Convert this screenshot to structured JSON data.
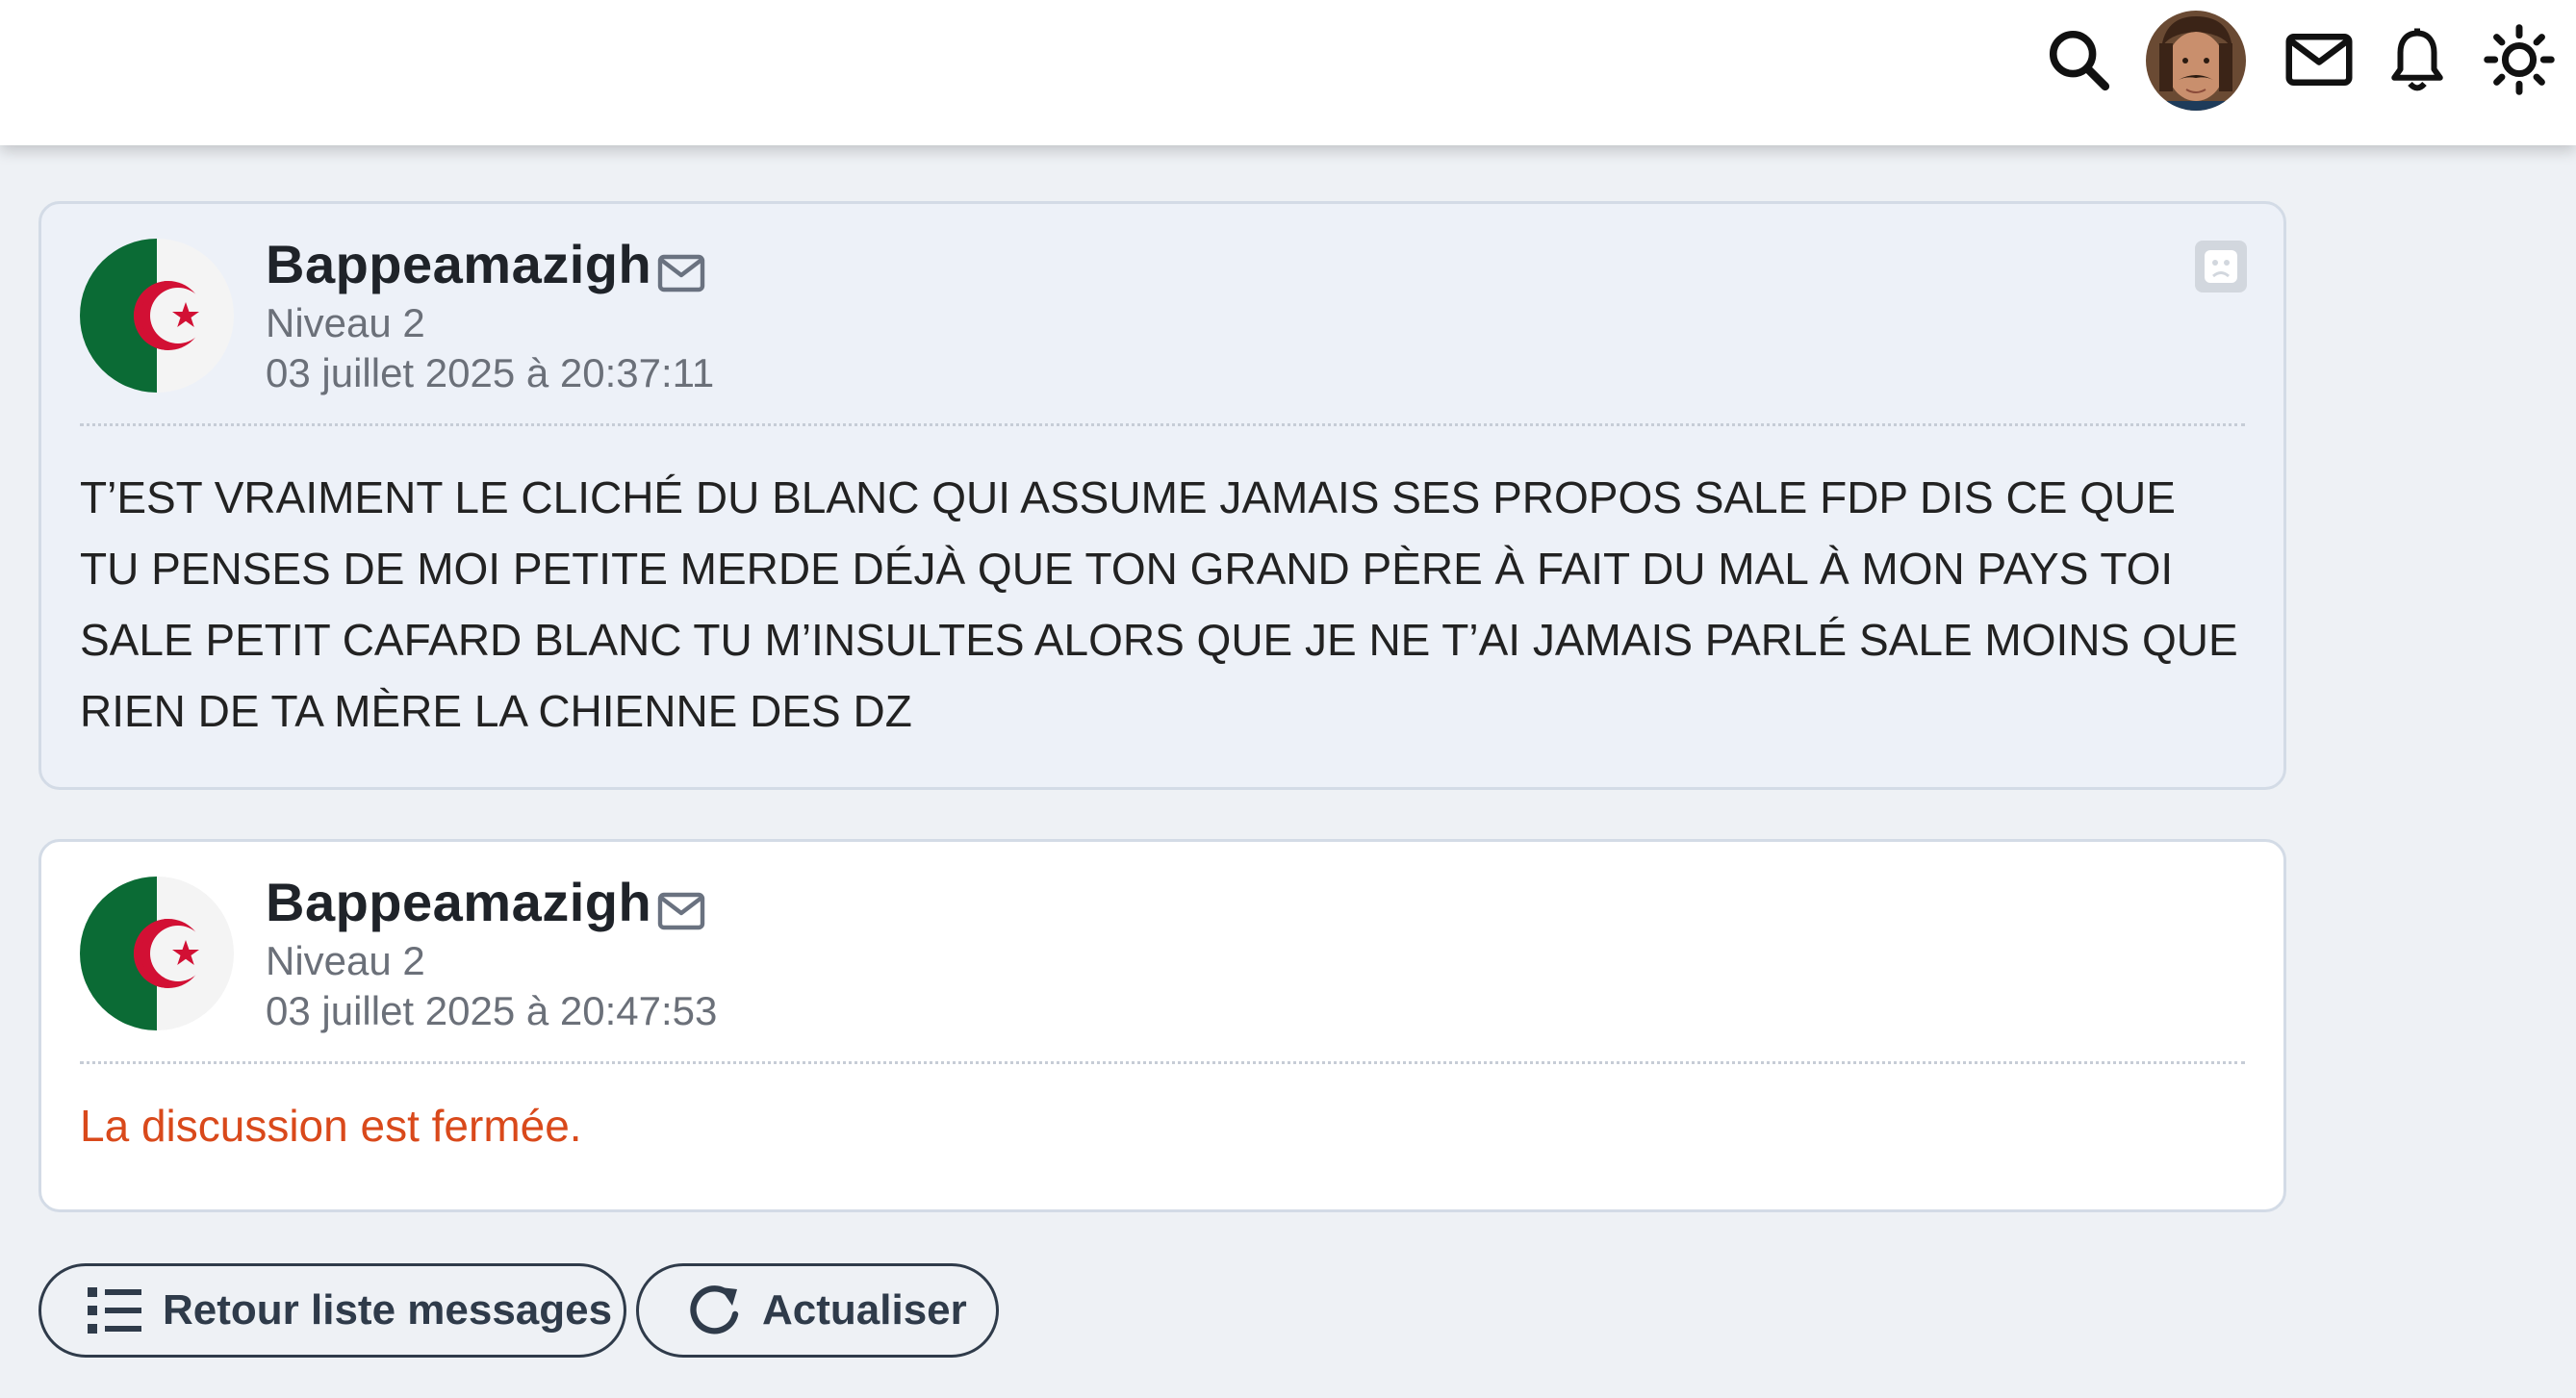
{
  "header": {
    "icons": {
      "search": "search-icon",
      "avatar": "user-avatar",
      "mail": "mail-icon",
      "bell": "bell-icon",
      "theme": "sun-icon"
    }
  },
  "messages": [
    {
      "author": "Bappeamazigh",
      "level": "Niveau 2",
      "date": "03 juillet 2025 à 20:37:11",
      "body": "T’EST VRAIMENT LE CLICHÉ DU BLANC QUI ASSUME JAMAIS SES PROPOS SALE FDP DIS CE QUE TU PENSES DE MOI PETITE MERDE DÉJÀ QUE TON GRAND PÈRE À FAIT DU MAL À MON PAYS TOI SALE PETIT CAFARD BLANC TU M’INSULTES ALORS QUE JE NE T’AI JAMAIS PARLÉ SALE MOINS QUE RIEN DE TA MÈRE LA CHIENNE DES DZ",
      "avatar": "algerian-flag"
    },
    {
      "author": "Bappeamazigh",
      "level": "Niveau 2",
      "date": "03 juillet 2025 à 20:47:53",
      "body": "La discussion est fermée.",
      "avatar": "algerian-flag"
    }
  ],
  "actions": {
    "back_label": "Retour liste messages",
    "refresh_label": "Actualiser"
  },
  "colors": {
    "closed_text": "#d9491b",
    "button_border": "#2f3b4a",
    "flag_green": "#0b6b35",
    "flag_red": "#d21034"
  }
}
